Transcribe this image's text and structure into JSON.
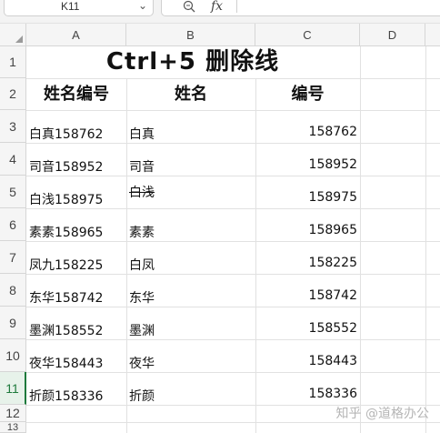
{
  "formula_bar": {
    "cell_ref": "K11",
    "fx_label": "fx"
  },
  "columns": [
    "A",
    "B",
    "C",
    "D"
  ],
  "rows": [
    "1",
    "2",
    "3",
    "4",
    "5",
    "6",
    "7",
    "8",
    "9",
    "10",
    "11",
    "12",
    "13"
  ],
  "active_row": "11",
  "sheet": {
    "title": "Ctrl+5 删除线",
    "headers": [
      "姓名编号",
      "姓名",
      "编号"
    ],
    "data": [
      {
        "combined": "白真158762",
        "name": "白真",
        "number": "158762",
        "strike": false
      },
      {
        "combined": "司音158952",
        "name": "司音",
        "number": "158952",
        "strike": false
      },
      {
        "combined": "白浅158975",
        "name": "白浅",
        "number": "158975",
        "strike": true
      },
      {
        "combined": "素素158965",
        "name": "素素",
        "number": "158965",
        "strike": false
      },
      {
        "combined": "凤九158225",
        "name": "白凤",
        "number": "158225",
        "strike": false
      },
      {
        "combined": "东华158742",
        "name": "东华",
        "number": "158742",
        "strike": false
      },
      {
        "combined": "墨渊158552",
        "name": "墨渊",
        "number": "158552",
        "strike": false
      },
      {
        "combined": "夜华158443",
        "name": "夜华",
        "number": "158443",
        "strike": false
      },
      {
        "combined": "折颜158336",
        "name": "折颜",
        "number": "158336",
        "strike": false
      }
    ]
  },
  "watermark": "知乎 @道格办公"
}
